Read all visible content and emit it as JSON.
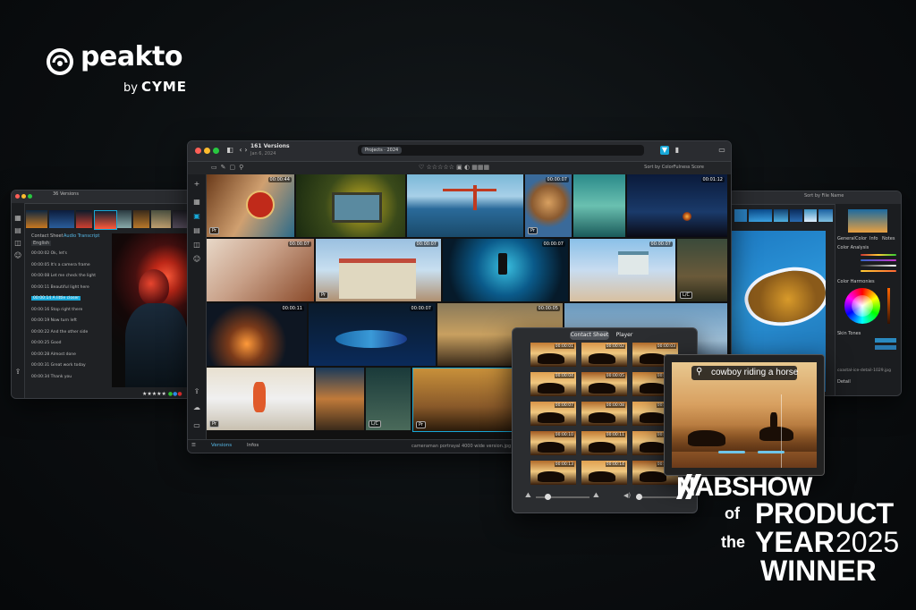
{
  "brand": {
    "name": "peakto",
    "by": "by",
    "maker": "CYME"
  },
  "main_window": {
    "title": "161 Versions",
    "subtitle": "Jan 6, 2024",
    "search_chip": "Projects · 2024",
    "sort_label": "Sort by ColorFulness Score",
    "tiles": [
      {
        "time": "00:00:44",
        "badge": "Pr"
      },
      {
        "time": "",
        "badge": ""
      },
      {
        "time": "",
        "badge": ""
      },
      {
        "time": "00:00:07",
        "badge": "Pr"
      },
      {
        "time": "",
        "badge": ""
      },
      {
        "time": "00:01:12",
        "badge": ""
      },
      {
        "time": "00:00:07",
        "badge": ""
      },
      {
        "time": "00:00:07",
        "badge": "Pr"
      },
      {
        "time": "00:00:07",
        "badge": ""
      },
      {
        "time": "00:00:07",
        "badge": ""
      },
      {
        "time": "",
        "badge": "L/C"
      },
      {
        "time": "00:00:11",
        "badge": ""
      },
      {
        "time": "00:00:07",
        "badge": ""
      },
      {
        "time": "00:00:05",
        "badge": ""
      },
      {
        "time": "00:00:11",
        "badge": "Pr"
      },
      {
        "time": "",
        "badge": "L/C"
      },
      {
        "time": "00:00:07",
        "badge": "Pr"
      }
    ],
    "footer": {
      "tab1": "Versions",
      "tab2": "Infos",
      "path": "cameraman portrayal 4000 wide version.jpg"
    }
  },
  "left_window": {
    "title": "36 Versions",
    "header1": "Contact Sheet",
    "header2": "Audio Transcript",
    "lang": "English",
    "transcript": [
      "00:00:02 Ok, let's",
      "00:00:05 It's a camera frame",
      "00:00:08 Let me check the light",
      "00:00:11 Beautiful light here",
      "00:00:14 A little closer",
      "00:00:16 Stop right there",
      "00:00:19 Now turn left",
      "00:00:22 And the other side",
      "00:00:25 Good",
      "00:00:28 Almost done",
      "00:00:31 Great work today",
      "00:00:34 Thank you"
    ]
  },
  "right_window": {
    "sort": "Sort by File Name",
    "tabs": [
      "General",
      "Color",
      "Info",
      "Notes"
    ],
    "section1": "Color Analysis",
    "section2": "Color Harmonies",
    "section3": "Skin Tones",
    "file": "coastal-ice-detail-1029.jpg",
    "field": "Detail"
  },
  "contact_sheet": {
    "seg1": "Contact Sheet",
    "seg2": "Player",
    "timecodes": [
      "00:00:01",
      "00:00:02",
      "00:00:03",
      "00:00:04",
      "00:00:05",
      "00:00:06",
      "00:00:07",
      "00:00:08",
      "00:00:09",
      "00:00:10",
      "00:00:11",
      "00:00:12",
      "00:00:13",
      "00:00:14",
      "00:00:15"
    ]
  },
  "player": {
    "query": "cowboy riding a horse"
  },
  "award": {
    "line1": "NABSHOW",
    "line2a": "of",
    "line2b": "PRODUCT",
    "line3a": "the",
    "line3b": "YEAR",
    "line3c": "2025",
    "line4": "WINNER"
  },
  "colors": {
    "accent": "#17a8d8",
    "bg": "#0b0e10"
  }
}
